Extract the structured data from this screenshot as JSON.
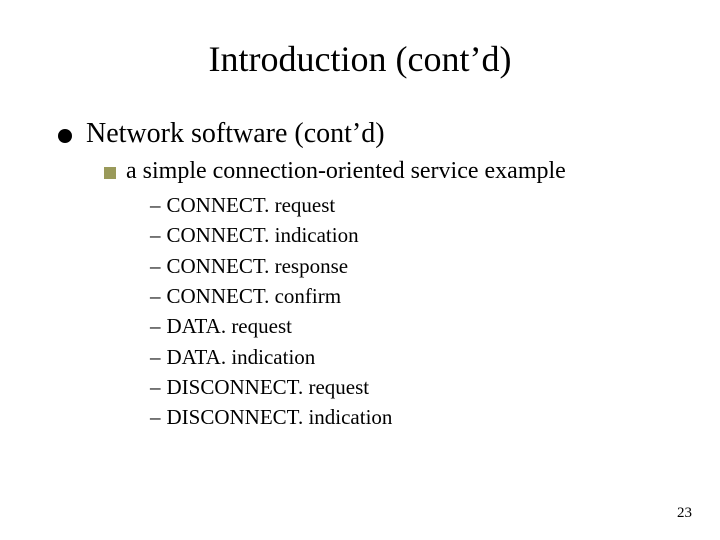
{
  "title": "Introduction (cont’d)",
  "level1": {
    "text": "Network software (cont’d)"
  },
  "level2": {
    "text": "a simple connection-oriented service example"
  },
  "items": [
    "CONNECT. request",
    "CONNECT. indication",
    "CONNECT. response",
    "CONNECT. confirm",
    "DATA. request",
    "DATA. indication",
    "DISCONNECT. request",
    "DISCONNECT. indication"
  ],
  "pageNumber": "23"
}
